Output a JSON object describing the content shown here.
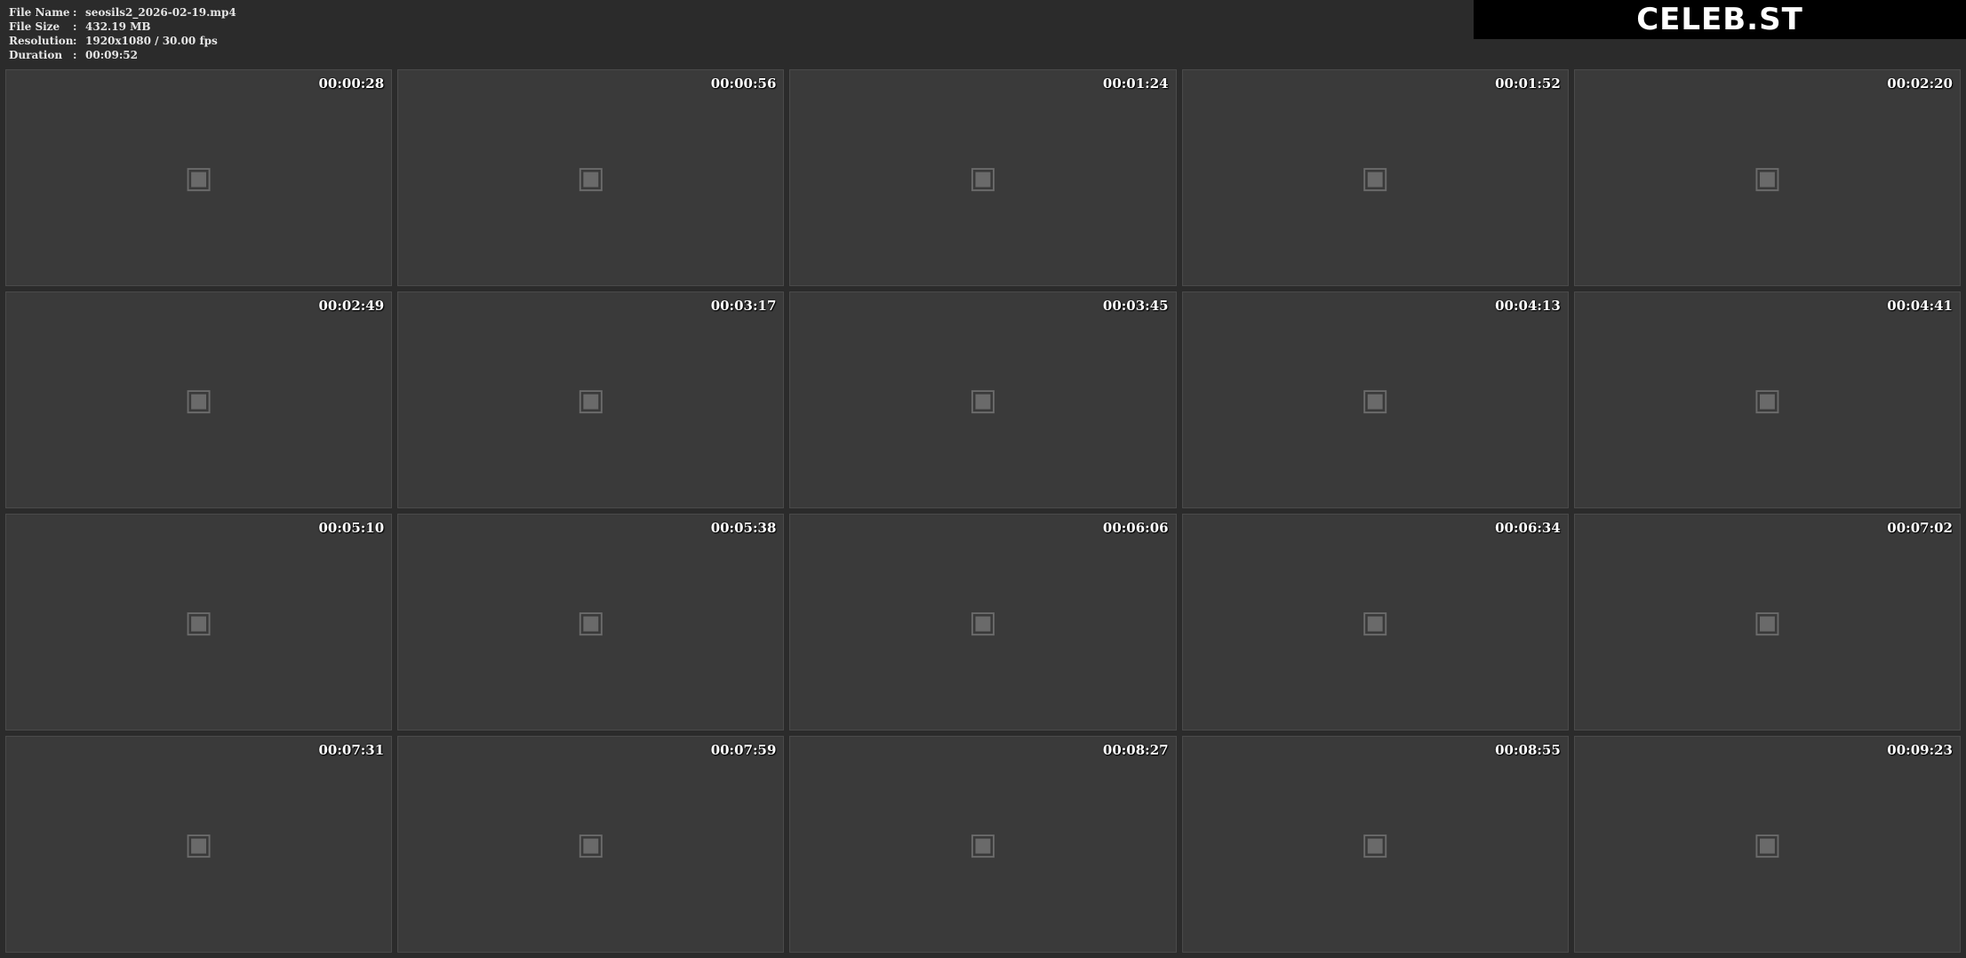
{
  "file_info": {
    "rows": [
      {
        "key": "File Name",
        "value": "seosils2_2026-02-19.mp4"
      },
      {
        "key": "File Size",
        "value": "432.19 MB"
      },
      {
        "key": "Resolution",
        "value": "1920x1080 / 30.00 fps"
      },
      {
        "key": "Duration",
        "value": "00:09:52"
      }
    ]
  },
  "brand": {
    "label": "CELEB.ST"
  },
  "placeholder_icon": "video-frame-icon",
  "frames": [
    {
      "time": "00:00:28"
    },
    {
      "time": "00:00:56"
    },
    {
      "time": "00:01:24"
    },
    {
      "time": "00:01:52"
    },
    {
      "time": "00:02:20"
    },
    {
      "time": "00:02:49"
    },
    {
      "time": "00:03:17"
    },
    {
      "time": "00:03:45"
    },
    {
      "time": "00:04:13"
    },
    {
      "time": "00:04:41"
    },
    {
      "time": "00:05:10"
    },
    {
      "time": "00:05:38"
    },
    {
      "time": "00:06:06"
    },
    {
      "time": "00:06:34"
    },
    {
      "time": "00:07:02"
    },
    {
      "time": "00:07:31"
    },
    {
      "time": "00:07:59"
    },
    {
      "time": "00:08:27"
    },
    {
      "time": "00:08:55"
    },
    {
      "time": "00:09:23"
    }
  ]
}
